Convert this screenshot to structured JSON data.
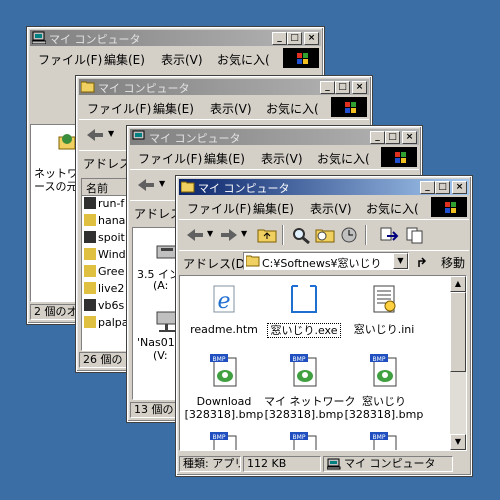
{
  "colors": {
    "desktop": "#3a6ea5",
    "title_active": "#0a246a",
    "title_inactive": "#808080"
  },
  "window_title": "マイ コンピュータ",
  "menu": {
    "file": "ファイル(F)",
    "edit": "編集(E)",
    "view": "表示(V)",
    "fav": "お気に入り",
    "fav_short": "お気に入(",
    "fav_short2": "お気に入",
    "fav_short3": "お気に入r"
  },
  "address_label": "アドレス(D)",
  "address_short": "アドレス(",
  "go_label": "移動",
  "w1": {
    "side_text_1": "ネットワー",
    "side_text_2": "ースの元",
    "status": "2 個のオ"
  },
  "w2": {
    "col_name": "名前",
    "rows": [
      "run-f",
      "hana",
      "spoit",
      "Wind",
      "Gree",
      "live2",
      "vb6s",
      "palpa"
    ],
    "status": "26 個の"
  },
  "w3": {
    "drive1_a": "3.5 イン",
    "drive1_b": "(A:",
    "drive2_a": "'Nas01' c",
    "drive2_b": "(V:",
    "status": "13 個の"
  },
  "w4": {
    "address": "C:¥Softnews¥窓いじり",
    "files": [
      {
        "name": "readme.htm",
        "icon": "ie-html-icon"
      },
      {
        "name": "窓いじり.exe",
        "icon": "exe-window-icon"
      },
      {
        "name": "窓いじり.ini",
        "icon": "ini-config-icon"
      },
      {
        "name": "Download\n[328318].bmp",
        "icon": "bmp-file-icon"
      },
      {
        "name": "マイ ネットワーク\n[328318].bmp",
        "icon": "bmp-file-icon"
      },
      {
        "name": "窓いじり\n[328318].bmp",
        "icon": "bmp-file-icon"
      }
    ],
    "status_type": "種類: アプリケ",
    "status_size": "112 KB",
    "status_zone": "マイ コンピュータ"
  }
}
